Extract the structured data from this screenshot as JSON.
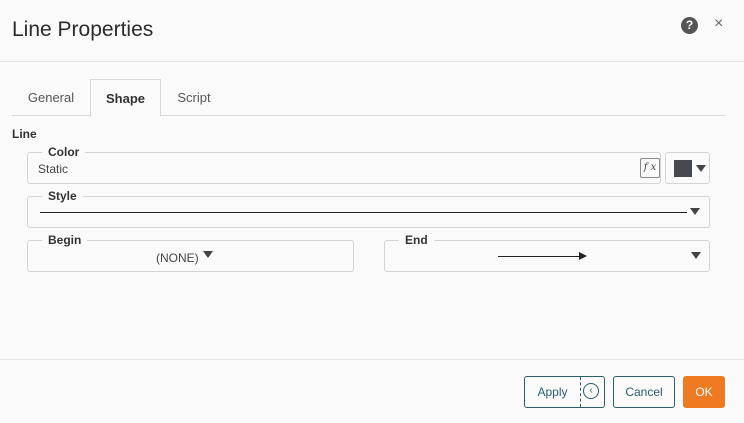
{
  "dialog": {
    "title": "Line Properties",
    "help_icon": "?",
    "close_icon": "×"
  },
  "tabs": [
    {
      "label": "General"
    },
    {
      "label": "Shape",
      "active": true
    },
    {
      "label": "Script"
    }
  ],
  "section": {
    "label": "Line"
  },
  "color": {
    "label": "Color",
    "value": "Static",
    "fx_icon": "f x",
    "swatch_color": "#454a50"
  },
  "style": {
    "label": "Style"
  },
  "begin": {
    "label": "Begin",
    "value": "(NONE)"
  },
  "end": {
    "label": "End"
  },
  "footer": {
    "apply_label": "Apply",
    "apply_dropdown_icon": "‹",
    "cancel_label": "Cancel",
    "ok_label": "OK",
    "accent_color": "#f07a21",
    "outline_color": "#2c5d6b"
  }
}
